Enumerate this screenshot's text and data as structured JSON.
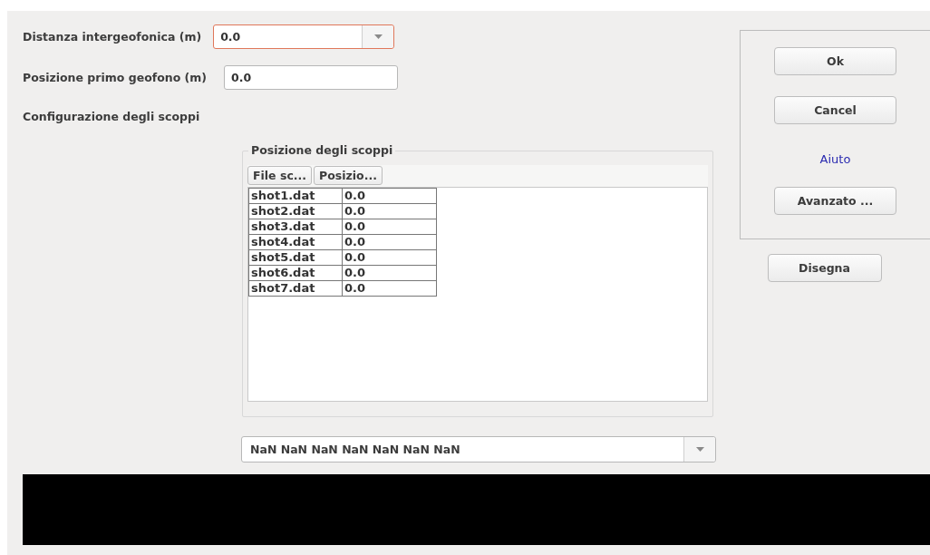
{
  "form": {
    "fields": [
      {
        "label": "Distanza intergeofonica (m)",
        "kind": "combo",
        "value": "0.0",
        "focused": true
      },
      {
        "label": "Posizione primo geofono (m)",
        "kind": "text",
        "value": "0.0",
        "focused": false
      }
    ],
    "section_label": "Configurazione degli scoppi"
  },
  "shots_group": {
    "title": "Posizione degli scoppi",
    "columns": [
      "File sc...",
      "Posizio..."
    ],
    "rows": [
      [
        "shot1.dat",
        "0.0"
      ],
      [
        "shot2.dat",
        "0.0"
      ],
      [
        "shot3.dat",
        "0.0"
      ],
      [
        "shot4.dat",
        "0.0"
      ],
      [
        "shot5.dat",
        "0.0"
      ],
      [
        "shot6.dat",
        "0.0"
      ],
      [
        "shot7.dat",
        "0.0"
      ]
    ]
  },
  "actions": [
    {
      "kind": "button",
      "label": "Ok"
    },
    {
      "kind": "button",
      "label": "Cancel"
    },
    {
      "kind": "link",
      "label": "Aiuto"
    },
    {
      "kind": "button",
      "label": "Avanzato ..."
    }
  ],
  "draw_button": "Disegna",
  "result_combo": {
    "value": "NaN NaN NaN NaN NaN NaN NaN"
  }
}
